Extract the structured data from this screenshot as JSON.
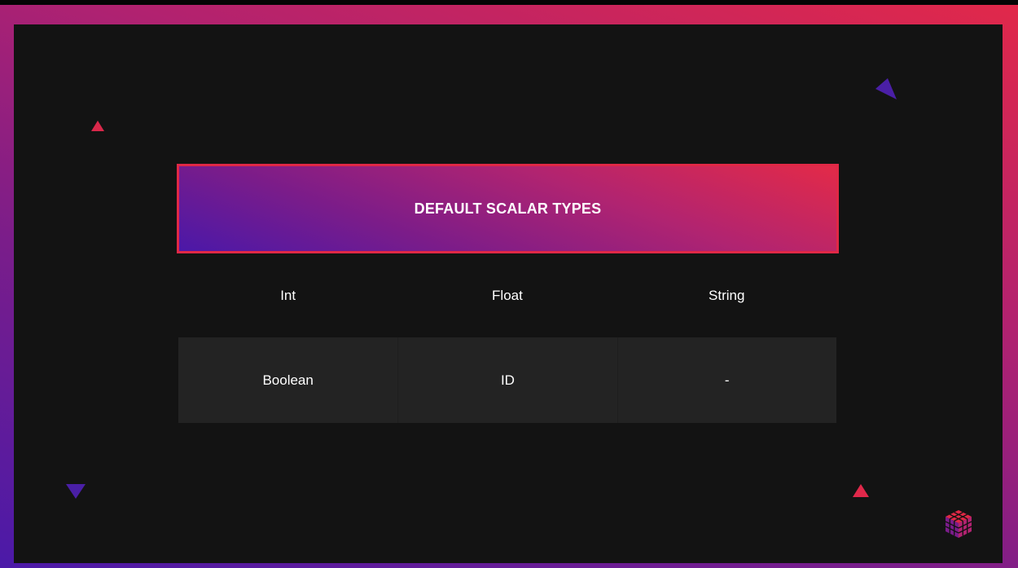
{
  "slide": {
    "title": "DEFAULT SCALAR TYPES",
    "table": {
      "rows": [
        [
          "Int",
          "Float",
          "String"
        ],
        [
          "Boolean",
          "ID",
          "-"
        ]
      ]
    }
  },
  "colors": {
    "background": "#131313",
    "accent_red": "#e02846",
    "accent_purple": "#4b18a8",
    "cell_fill": "#232323"
  },
  "icons": [
    "triangle-decor-icon",
    "cube-logo-icon"
  ]
}
